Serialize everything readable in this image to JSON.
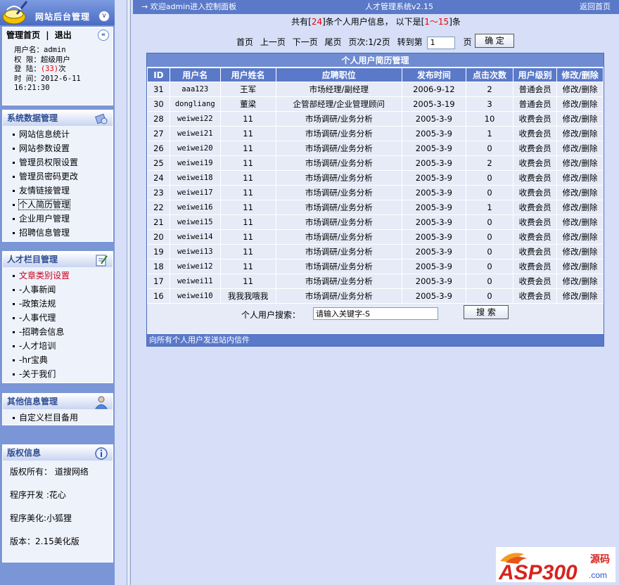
{
  "sidebar": {
    "logo_title": "网站后台管理",
    "nav": {
      "home": "管理首页",
      "separator": "|",
      "logout": "退出"
    },
    "user": {
      "username_label": "用户名：",
      "username": "admin",
      "role_label": "权  限：",
      "role": "超级用户",
      "login_label": "登  陆：",
      "login_count": "(33)",
      "login_suffix": "次",
      "time_label": "时  间：",
      "time_date": "2012-6-11",
      "time_clock": "16:21:30"
    },
    "system_panel": {
      "title": "系统数据管理",
      "items": [
        "网站信息统计",
        "网站参数设置",
        "管理员权限设置",
        "管理员密码更改",
        "友情链接管理",
        "个人简历管理",
        "企业用户管理",
        "招聘信息管理"
      ]
    },
    "talent_panel": {
      "title": "人才栏目管理",
      "items": [
        "文章类别设置",
        "-人事新闻",
        "-政策法规",
        "-人事代理",
        "-招聘会信息",
        "-人才培训",
        "-hr宝典",
        "-关于我们"
      ]
    },
    "other_panel": {
      "title": "其他信息管理",
      "items": [
        "自定义栏目备用"
      ]
    },
    "copyright_panel": {
      "title": "版权信息",
      "lines": [
        "版权所有： 道搜网络",
        "程序开发 :花心",
        "程序美化:小狐狸",
        "版本：2.15美化版"
      ]
    }
  },
  "topbar": {
    "welcome": "→ 欢迎admin进入控制面板",
    "system_name": "人才管理系统v2.15",
    "back_home": "返回首页"
  },
  "summary": {
    "prefix": "共有[",
    "total": "24",
    "mid": "]条个人用户信息， 以下是[",
    "range": "1～15",
    "suffix": "]条"
  },
  "pager": {
    "first": "首页",
    "prev": "上一页",
    "next": "下一页",
    "last": "尾页",
    "page_info": "页次:1/2页",
    "goto_label": "转到第",
    "goto_value": "1",
    "page_suffix": "页",
    "confirm": "确 定"
  },
  "grid": {
    "title": "个人用户简历管理",
    "columns": [
      "ID",
      "用户名",
      "用户姓名",
      "应聘职位",
      "发布时间",
      "点击次数",
      "用户级别",
      "修改/删除"
    ],
    "rows": [
      {
        "id": "31",
        "username": "aaa123",
        "realname": "王军",
        "position": "市场经理/副经理",
        "date": "2006-9-12",
        "clicks": "2",
        "level": "普通会员",
        "action": "修改/删除"
      },
      {
        "id": "30",
        "username": "dongliang",
        "realname": "董梁",
        "position": "企管部经理/企业管理顾问",
        "date": "2005-3-19",
        "clicks": "3",
        "level": "普通会员",
        "action": "修改/删除"
      },
      {
        "id": "28",
        "username": "weiwei22",
        "realname": "11",
        "position": "市场调研/业务分析",
        "date": "2005-3-9",
        "clicks": "10",
        "level": "收费会员",
        "action": "修改/删除"
      },
      {
        "id": "27",
        "username": "weiwei21",
        "realname": "11",
        "position": "市场调研/业务分析",
        "date": "2005-3-9",
        "clicks": "1",
        "level": "收费会员",
        "action": "修改/删除"
      },
      {
        "id": "26",
        "username": "weiwei20",
        "realname": "11",
        "position": "市场调研/业务分析",
        "date": "2005-3-9",
        "clicks": "0",
        "level": "收费会员",
        "action": "修改/删除"
      },
      {
        "id": "25",
        "username": "weiwei19",
        "realname": "11",
        "position": "市场调研/业务分析",
        "date": "2005-3-9",
        "clicks": "2",
        "level": "收费会员",
        "action": "修改/删除"
      },
      {
        "id": "24",
        "username": "weiwei18",
        "realname": "11",
        "position": "市场调研/业务分析",
        "date": "2005-3-9",
        "clicks": "0",
        "level": "收费会员",
        "action": "修改/删除"
      },
      {
        "id": "23",
        "username": "weiwei17",
        "realname": "11",
        "position": "市场调研/业务分析",
        "date": "2005-3-9",
        "clicks": "0",
        "level": "收费会员",
        "action": "修改/删除"
      },
      {
        "id": "22",
        "username": "weiwei16",
        "realname": "11",
        "position": "市场调研/业务分析",
        "date": "2005-3-9",
        "clicks": "1",
        "level": "收费会员",
        "action": "修改/删除"
      },
      {
        "id": "21",
        "username": "weiwei15",
        "realname": "11",
        "position": "市场调研/业务分析",
        "date": "2005-3-9",
        "clicks": "0",
        "level": "收费会员",
        "action": "修改/删除"
      },
      {
        "id": "20",
        "username": "weiwei14",
        "realname": "11",
        "position": "市场调研/业务分析",
        "date": "2005-3-9",
        "clicks": "0",
        "level": "收费会员",
        "action": "修改/删除"
      },
      {
        "id": "19",
        "username": "weiwei13",
        "realname": "11",
        "position": "市场调研/业务分析",
        "date": "2005-3-9",
        "clicks": "0",
        "level": "收费会员",
        "action": "修改/删除"
      },
      {
        "id": "18",
        "username": "weiwei12",
        "realname": "11",
        "position": "市场调研/业务分析",
        "date": "2005-3-9",
        "clicks": "0",
        "level": "收费会员",
        "action": "修改/删除"
      },
      {
        "id": "17",
        "username": "weiwei11",
        "realname": "11",
        "position": "市场调研/业务分析",
        "date": "2005-3-9",
        "clicks": "0",
        "level": "收费会员",
        "action": "修改/删除"
      },
      {
        "id": "16",
        "username": "weiwei10",
        "realname": "我我我哦我",
        "position": "市场调研/业务分析",
        "date": "2005-3-9",
        "clicks": "0",
        "level": "收费会员",
        "action": "修改/删除"
      }
    ],
    "search_label": "个人用户搜索：",
    "search_value": "请输入关键字-S",
    "search_button": "搜 索",
    "footer": "向所有个人用户发送站内信件"
  },
  "brand": {
    "logo_text": "ASP300",
    "sub_cn": "源码",
    "domain": ".com"
  },
  "colors": {
    "page_bg": "#d6dff7",
    "sidebar_bg": "#7b96d6",
    "header_blue": "#5a79c9",
    "row_bg": "#e6ebf7",
    "accent_red": "#e00000"
  },
  "icons": {
    "logo": "broom-bucket-icon",
    "system_panel": "gear-cube-icon",
    "talent_panel": "notepad-pencil-icon",
    "other_panel": "user-icon",
    "copyright_panel": "info-icon",
    "collapse": "double-chevron-down-icon",
    "back": "double-chevron-left-icon"
  }
}
